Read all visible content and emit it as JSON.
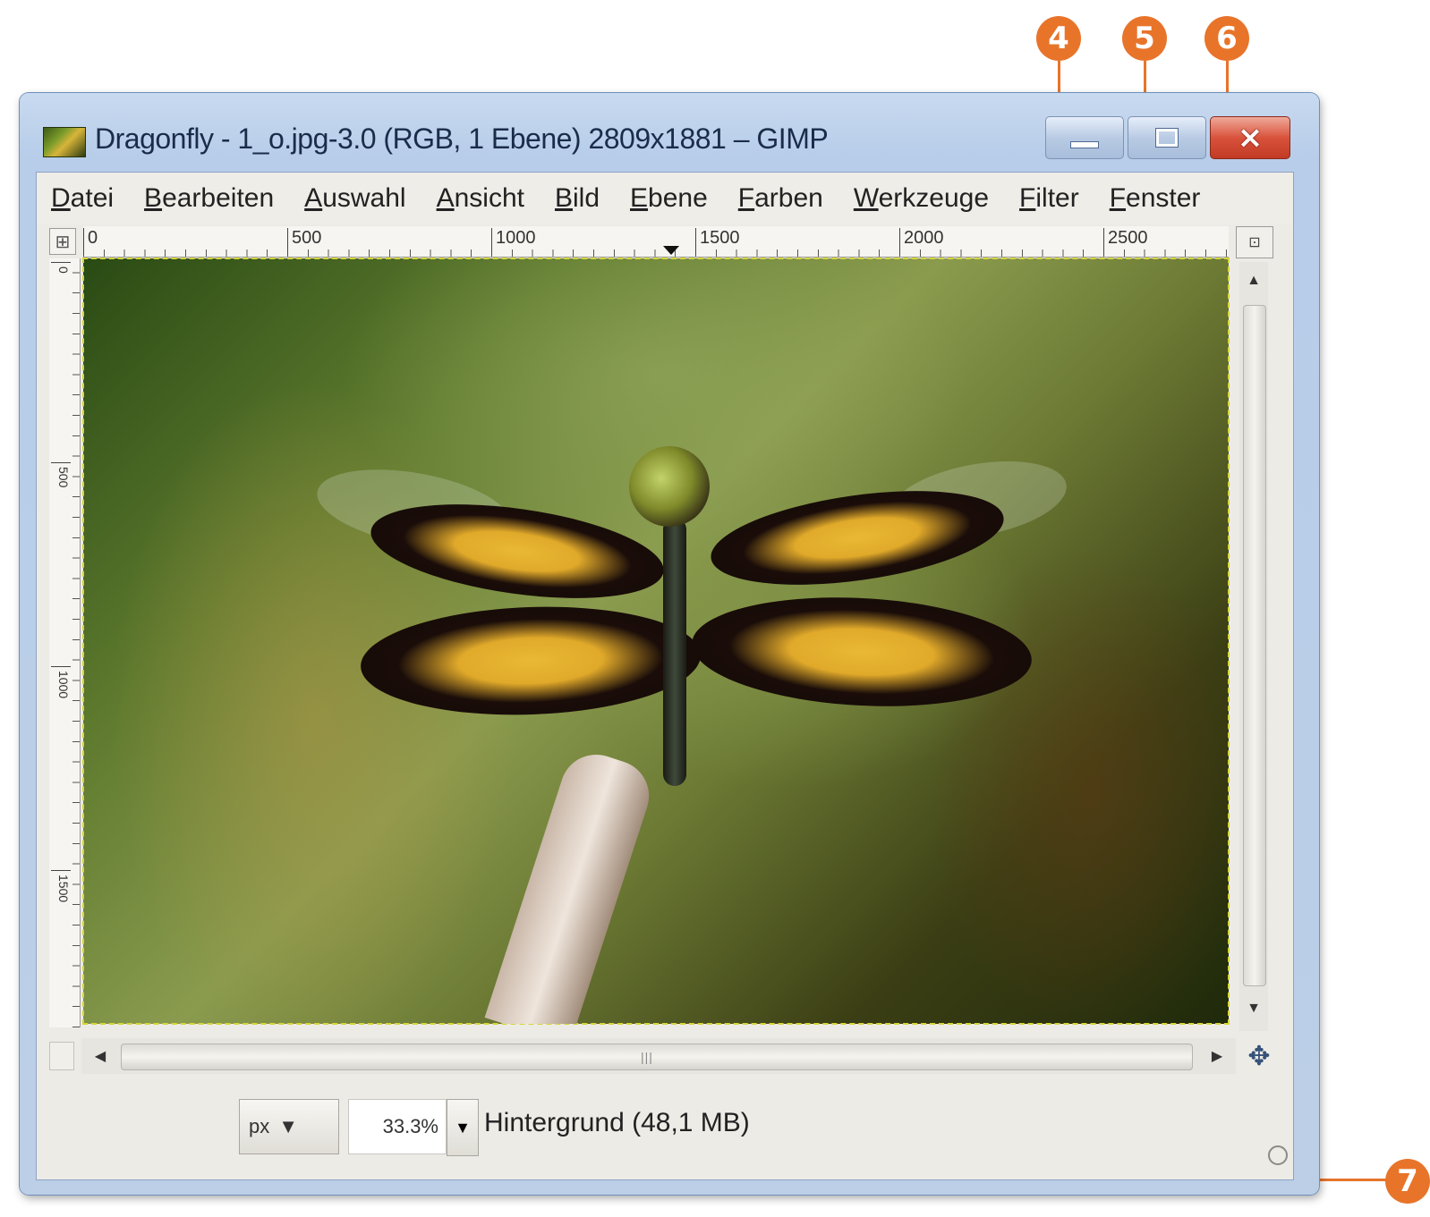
{
  "callouts": [
    "4",
    "5",
    "6",
    "7"
  ],
  "window": {
    "title": "Dragonfly - 1_o.jpg-3.0 (RGB, 1 Ebene) 2809x1881 – GIMP",
    "controls": {
      "minimize": "–",
      "maximize": "□",
      "close": "×"
    }
  },
  "menu": [
    "Datei",
    "Bearbeiten",
    "Auswahl",
    "Ansicht",
    "Bild",
    "Ebene",
    "Farben",
    "Werkzeuge",
    "Filter",
    "Fenster"
  ],
  "rulers": {
    "horizontal_labels": [
      "0",
      "500",
      "1000",
      "1500",
      "2000",
      "2500"
    ],
    "vertical_labels": [
      "0",
      "500",
      "1000",
      "1500"
    ]
  },
  "statusbar": {
    "unit": "px",
    "zoom": "33.3%",
    "layer_info": "Hintergrund (48,1 MB)"
  },
  "icons": {
    "ruler_corner": "quick-mask-icon",
    "navigate": "move-cross-icon",
    "dropdown": "chevron-down-icon"
  }
}
